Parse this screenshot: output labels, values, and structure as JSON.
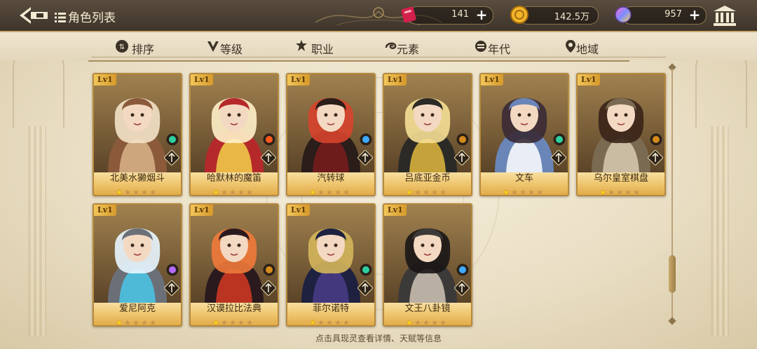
{
  "header": {
    "title": "角色列表",
    "back_icon": "back-arrow-icon",
    "list_icon": "list-icon"
  },
  "resources": [
    {
      "name": "ticket",
      "icon": "red-ticket-icon",
      "value": "141"
    },
    {
      "name": "gold",
      "icon": "gold-coin-icon",
      "value": "142.5万"
    },
    {
      "name": "gem",
      "icon": "rainbow-gem-icon",
      "value": "957"
    }
  ],
  "filters": [
    {
      "label": "排序",
      "icon": "sort-icon"
    },
    {
      "label": "等级",
      "icon": "level-v-icon"
    },
    {
      "label": "职业",
      "icon": "class-icon"
    },
    {
      "label": "元素",
      "icon": "element-swirl-icon"
    },
    {
      "label": "年代",
      "icon": "era-icon"
    },
    {
      "label": "地域",
      "icon": "location-pin-icon"
    }
  ],
  "characters": [
    {
      "name": "北美水獭烟斗",
      "level": "Lv1",
      "stars": 1,
      "max_stars": 5,
      "element": "wind",
      "class": "tower"
    },
    {
      "name": "哈默林的魔笛",
      "level": "Lv1",
      "stars": 1,
      "max_stars": 5,
      "element": "fire",
      "class": "scepter"
    },
    {
      "name": "汽转球",
      "level": "Lv1",
      "stars": 1,
      "max_stars": 5,
      "element": "water",
      "class": "scepter"
    },
    {
      "name": "吕底亚金币",
      "level": "Lv1",
      "stars": 1,
      "max_stars": 5,
      "element": "earth",
      "class": "scepter"
    },
    {
      "name": "文车",
      "level": "Lv1",
      "stars": 1,
      "max_stars": 5,
      "element": "wind",
      "class": "tower"
    },
    {
      "name": "乌尔皇室棋盘",
      "level": "Lv1",
      "stars": 1,
      "max_stars": 5,
      "element": "earth",
      "class": "tower"
    },
    {
      "name": "爱尼阿克",
      "level": "Lv1",
      "stars": 1,
      "max_stars": 5,
      "element": "thunder",
      "class": "scepter"
    },
    {
      "name": "汉谟拉比法典",
      "level": "Lv1",
      "stars": 1,
      "max_stars": 5,
      "element": "earth",
      "class": "scepter"
    },
    {
      "name": "菲尔诺特",
      "level": "Lv1",
      "stars": 1,
      "max_stars": 5,
      "element": "wind",
      "class": "scepter"
    },
    {
      "name": "文王八卦镜",
      "level": "Lv1",
      "stars": 1,
      "max_stars": 5,
      "element": "water",
      "class": "shield"
    }
  ],
  "hint": "点击具现灵查看详情、天赋等信息",
  "colors": {
    "wind": "#2ecfa0",
    "fire": "#ff5a1e",
    "water": "#3fa9ff",
    "earth": "#d48a1c",
    "thunder": "#b46bff"
  }
}
